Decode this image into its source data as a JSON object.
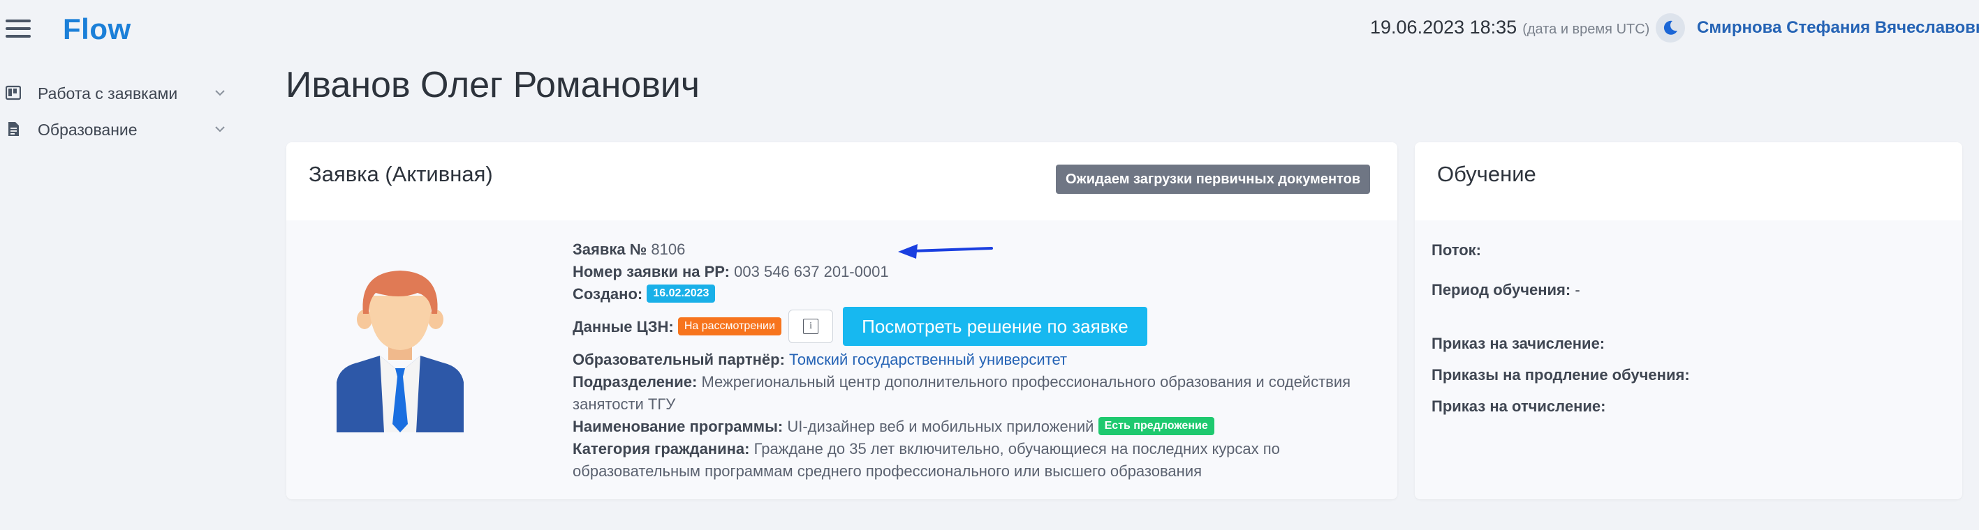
{
  "app": {
    "logo": "Flow",
    "datetime": "19.06.2023 18:35",
    "datetime_note": "(дата и время UTC)",
    "user": "Смирнова Стефания Вячеславовна"
  },
  "sidebar": {
    "items": [
      {
        "label": "Работа с заявками",
        "icon": "kanban-icon"
      },
      {
        "label": "Образование",
        "icon": "document-icon"
      }
    ]
  },
  "page": {
    "title": "Иванов Олег Романович"
  },
  "application": {
    "title": "Заявка (Активная)",
    "status": "Ожидаем загрузки первичных документов",
    "number_label": "Заявка №",
    "number_value": "8106",
    "rr_label": "Номер заявки на РР:",
    "rr_value": "003 546 637 201-0001",
    "created_label": "Создано:",
    "created_value": "16.02.2023",
    "czn_label": "Данные ЦЗН:",
    "czn_status": "На рассмотрении",
    "info_icon": "info-icon",
    "view_decision": "Посмотреть решение по заявке",
    "partner_label": "Образовательный партнёр:",
    "partner_value": "Томский государственный университет",
    "division_label": "Подразделение:",
    "division_value": "Межрегиональный центр дополнительного профессионального образования и содействия занятости ТГУ",
    "program_label": "Наименование программы:",
    "program_value": "UI-дизайнер веб и мобильных приложений",
    "program_badge": "Есть предложение",
    "category_label": "Категория гражданина:",
    "category_value": "Граждане до 35 лет включительно, обучающиеся на последних курсах по образовательным программам среднего профессионального или высшего образования"
  },
  "training": {
    "title": "Обучение",
    "stream_label": "Поток:",
    "period_label": "Период обучения:",
    "period_value": "-",
    "enroll_label": "Приказ на зачисление:",
    "extend_label": "Приказы на продление обучения:",
    "expel_label": "Приказ на отчисление:"
  },
  "colors": {
    "accent": "#1b7fd8",
    "primary_button": "#17b8f0",
    "status_grey": "#6f7684",
    "badge_orange": "#f7741d",
    "badge_green": "#1ec96f",
    "arrow": "#1a3fe0"
  }
}
